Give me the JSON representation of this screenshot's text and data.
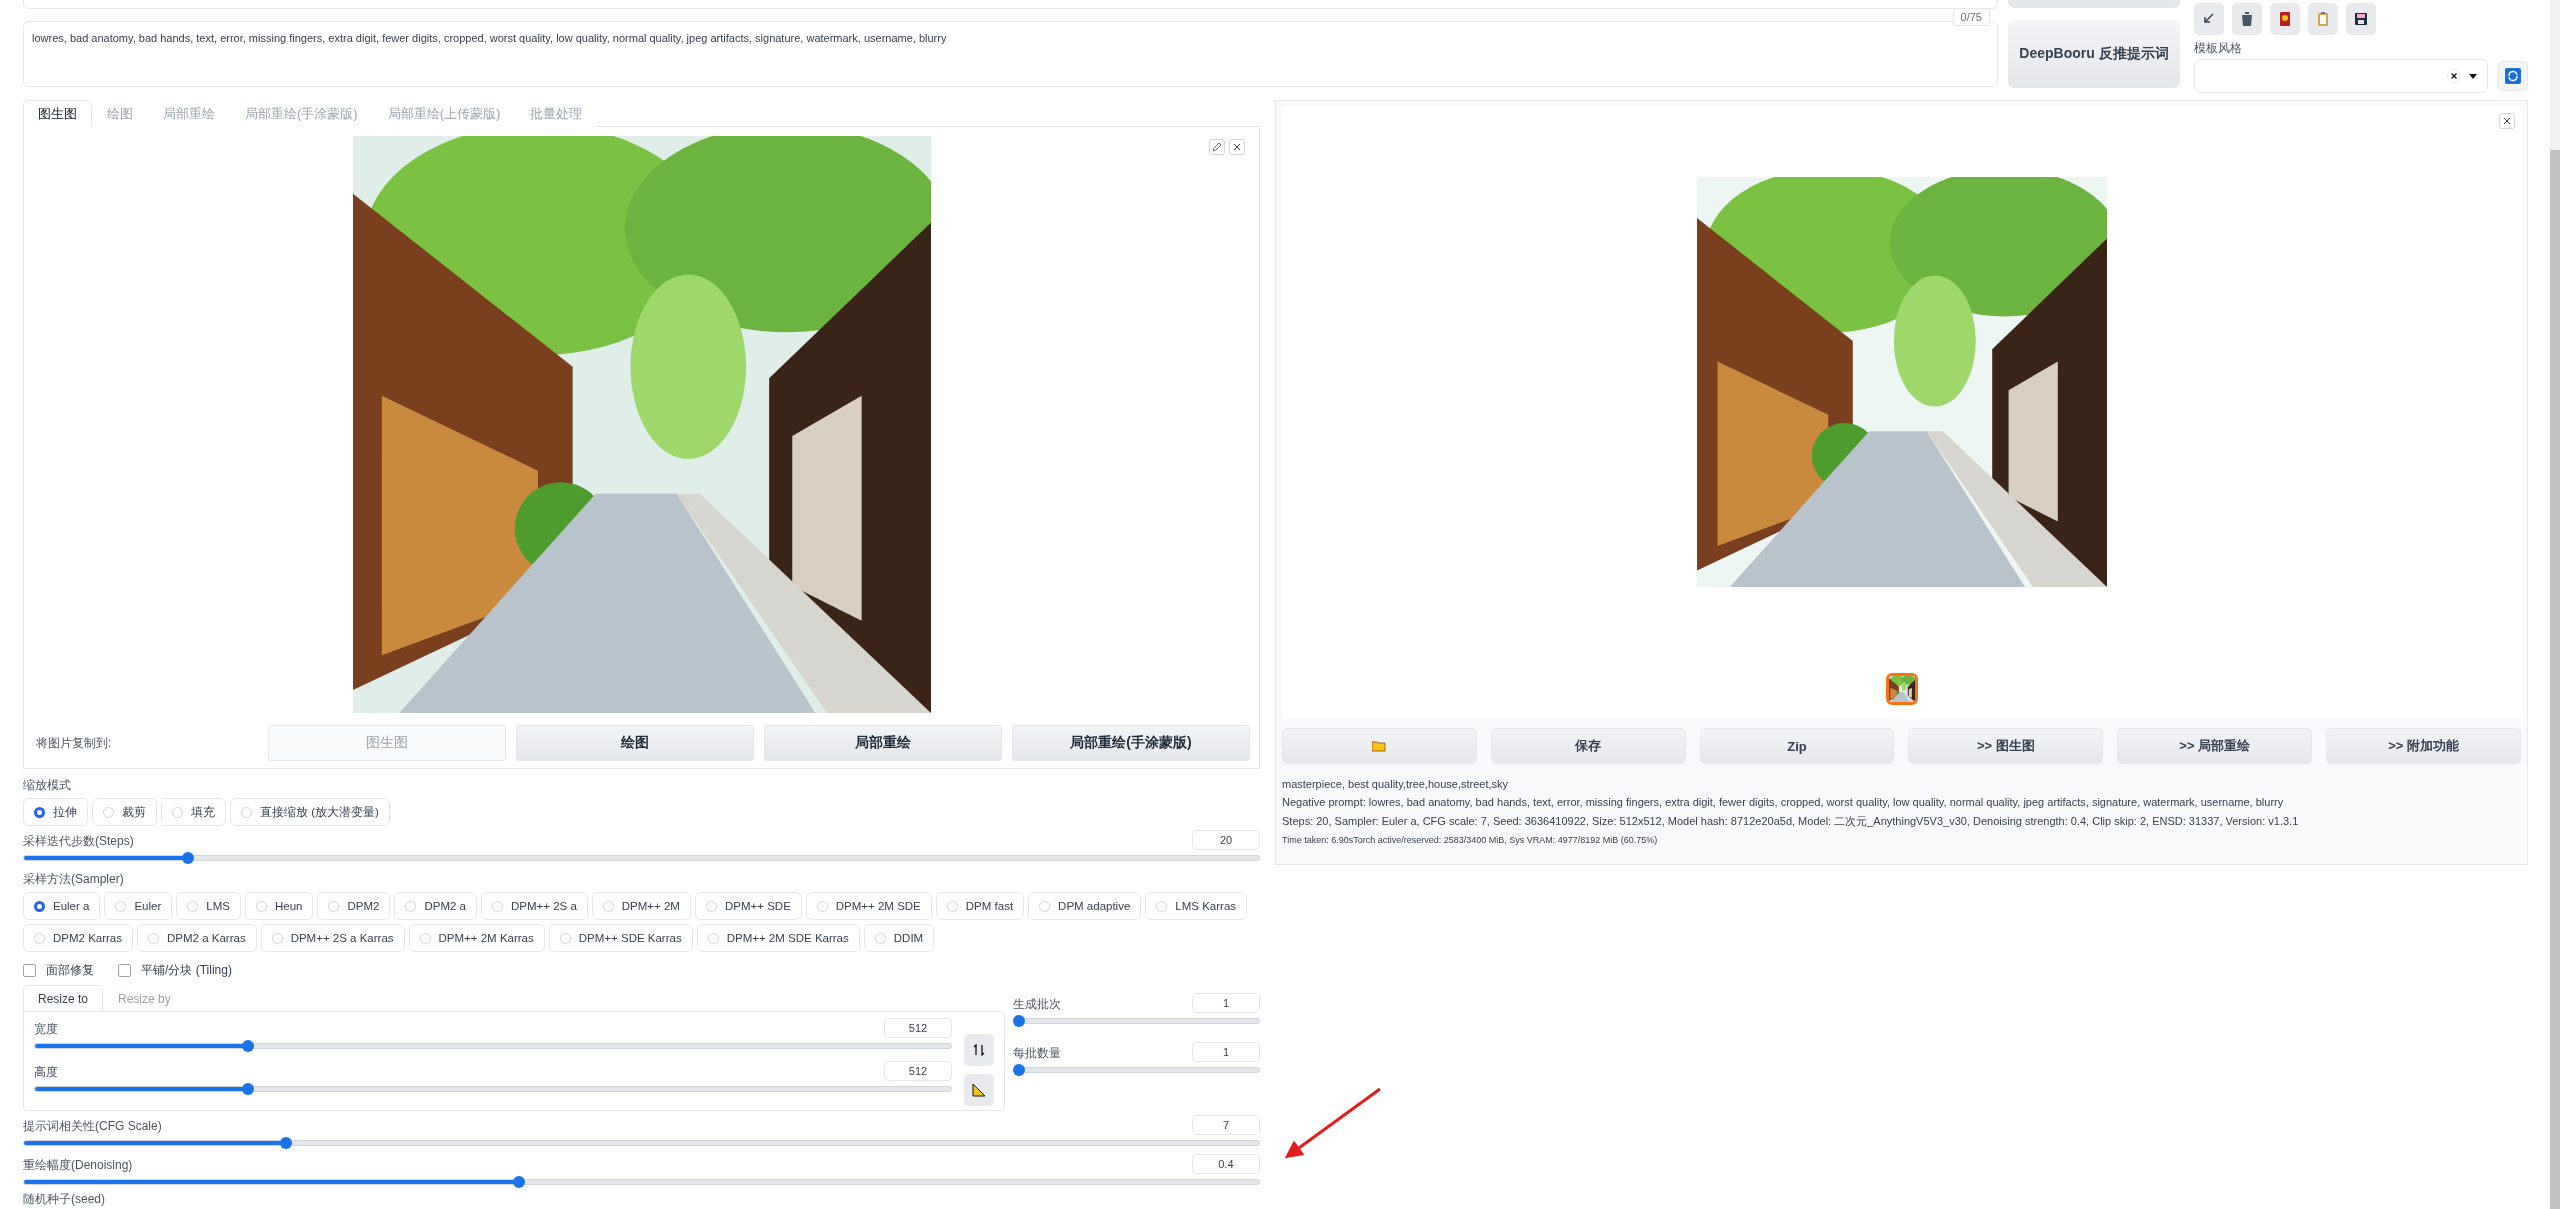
{
  "negative_prompt": {
    "value": "lowres, bad anatomy, bad hands, text, error, missing fingers, extra digit, fewer digits, cropped, worst quality, low quality, normal quality, jpeg artifacts, signature, watermark, username, blurry",
    "token_count": "0/75"
  },
  "interrogate_button": "DeepBooru 反推提示词",
  "style": {
    "label": "模板风格"
  },
  "tabs": [
    {
      "label": "图生图",
      "selected": true
    },
    {
      "label": "绘图",
      "selected": false
    },
    {
      "label": "局部重绘",
      "selected": false
    },
    {
      "label": "局部重绘(手涂蒙版)",
      "selected": false
    },
    {
      "label": "局部重绘(上传蒙版)",
      "selected": false
    },
    {
      "label": "批量处理",
      "selected": false
    }
  ],
  "copy_to": {
    "label": "将图片复制到:",
    "buttons": [
      {
        "label": "图生图",
        "disabled": true
      },
      {
        "label": "绘图",
        "disabled": false
      },
      {
        "label": "局部重绘",
        "disabled": false
      },
      {
        "label": "局部重绘(手涂蒙版)",
        "disabled": false
      }
    ]
  },
  "resize_mode": {
    "label": "缩放模式",
    "options": [
      {
        "label": "拉伸",
        "selected": true
      },
      {
        "label": "裁剪",
        "selected": false
      },
      {
        "label": "填充",
        "selected": false
      },
      {
        "label": "直接缩放 (放大潜变量)",
        "selected": false
      }
    ]
  },
  "steps": {
    "label": "采样迭代步数(Steps)",
    "value": "20",
    "level": 0.13
  },
  "sampler": {
    "label": "采样方法(Sampler)",
    "options": [
      {
        "label": "Euler a",
        "selected": true
      },
      {
        "label": "Euler",
        "selected": false
      },
      {
        "label": "LMS",
        "selected": false
      },
      {
        "label": "Heun",
        "selected": false
      },
      {
        "label": "DPM2",
        "selected": false
      },
      {
        "label": "DPM2 a",
        "selected": false
      },
      {
        "label": "DPM++ 2S a",
        "selected": false
      },
      {
        "label": "DPM++ 2M",
        "selected": false
      },
      {
        "label": "DPM++ SDE",
        "selected": false
      },
      {
        "label": "DPM++ 2M SDE",
        "selected": false
      },
      {
        "label": "DPM fast",
        "selected": false
      },
      {
        "label": "DPM adaptive",
        "selected": false
      },
      {
        "label": "LMS Karras",
        "selected": false
      },
      {
        "label": "DPM2 Karras",
        "selected": false
      },
      {
        "label": "DPM2 a Karras",
        "selected": false
      },
      {
        "label": "DPM++ 2S a Karras",
        "selected": false
      },
      {
        "label": "DPM++ 2M Karras",
        "selected": false
      },
      {
        "label": "DPM++ SDE Karras",
        "selected": false
      },
      {
        "label": "DPM++ 2M SDE Karras",
        "selected": false
      },
      {
        "label": "DDIM",
        "selected": false
      }
    ]
  },
  "checkboxes": [
    {
      "label": "面部修复",
      "checked": false
    },
    {
      "label": "平铺/分块 (Tiling)",
      "checked": false
    }
  ],
  "size_tabs": [
    {
      "label": "Resize to",
      "selected": true
    },
    {
      "label": "Resize by",
      "selected": false
    }
  ],
  "width": {
    "label": "宽度",
    "value": "512",
    "level": 0.23
  },
  "height": {
    "label": "高度",
    "value": "512",
    "level": 0.23
  },
  "batch_count": {
    "label": "生成批次",
    "value": "1",
    "level": 0
  },
  "batch_size": {
    "label": "每批数量",
    "value": "1",
    "level": 0
  },
  "cfg": {
    "label": "提示词相关性(CFG Scale)",
    "value": "7",
    "level": 0.21
  },
  "denoising": {
    "label": "重绘幅度(Denoising)",
    "value": "0.4",
    "level": 0.4
  },
  "seed": {
    "label": "随机种子(seed)"
  },
  "output": {
    "buttons": [
      {
        "kind": "folder"
      },
      {
        "kind": "text",
        "label": "保存"
      },
      {
        "kind": "text",
        "label": "Zip"
      },
      {
        "kind": "text",
        "label": ">> 图生图"
      },
      {
        "kind": "text",
        "label": ">> 局部重绘"
      },
      {
        "kind": "text",
        "label": ">> 附加功能"
      }
    ],
    "info": [
      {
        "kind": "line",
        "text": "masterpiece, best quality,tree,house,street,sky"
      },
      {
        "kind": "line",
        "text": "Negative prompt: lowres, bad anatomy, bad hands, text, error, missing fingers, extra digit, fewer digits, cropped, worst quality, low quality, normal quality, jpeg artifacts, signature, watermark, username, blurry"
      },
      {
        "kind": "line",
        "text": "Steps: 20, Sampler: Euler a, CFG scale: 7, Seed: 3636410922, Size: 512x512, Model hash: 8712e20a5d, Model: 二次元_AnythingV5V3_v30, Denoising strength: 0.4, Clip skip: 2, ENSD: 31337, Version: v1.3.1"
      },
      {
        "kind": "small",
        "text": "Time taken: 6.90sTorch active/reserved: 2583/3400 MiB, Sys VRAM: 4977/8192 MiB (60.75%)"
      }
    ]
  }
}
